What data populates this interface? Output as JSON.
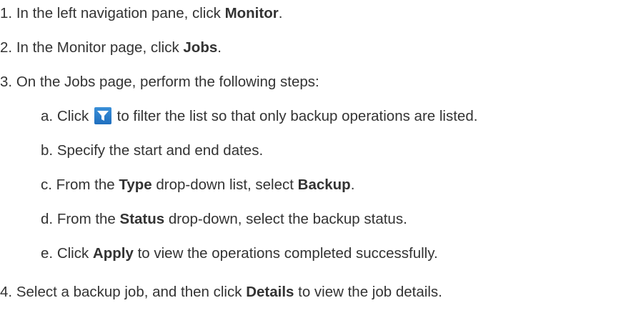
{
  "steps": [
    {
      "num": "1.",
      "pre": "In the left navigation pane, click ",
      "bold": "Monitor",
      "post": "."
    },
    {
      "num": "2.",
      "pre": "In the Monitor page, click ",
      "bold": "Jobs",
      "post": "."
    },
    {
      "num": "3.",
      "text": "On the Jobs page, perform the following steps:"
    },
    {
      "num": "4.",
      "pre": "Select a backup job, and then click ",
      "bold": "Details",
      "post": " to view the job details."
    }
  ],
  "substeps": [
    {
      "letter": "a.",
      "pre": "Click ",
      "icon": "filter-icon",
      "post": " to filter the list so that only backup operations are listed."
    },
    {
      "letter": "b.",
      "text": "Specify the start and end dates."
    },
    {
      "letter": "c.",
      "pre": "From the ",
      "bold1": "Type",
      "mid": " drop-down list, select ",
      "bold2": "Backup",
      "post": "."
    },
    {
      "letter": "d.",
      "pre": "From the ",
      "bold1": "Status",
      "post": " drop-down, select the backup status."
    },
    {
      "letter": "e.",
      "pre": "Click ",
      "bold1": "Apply",
      "post": " to view the operations completed successfully."
    }
  ],
  "colors": {
    "text": "#333333",
    "filter_icon_bg": "#2a7fcf"
  }
}
